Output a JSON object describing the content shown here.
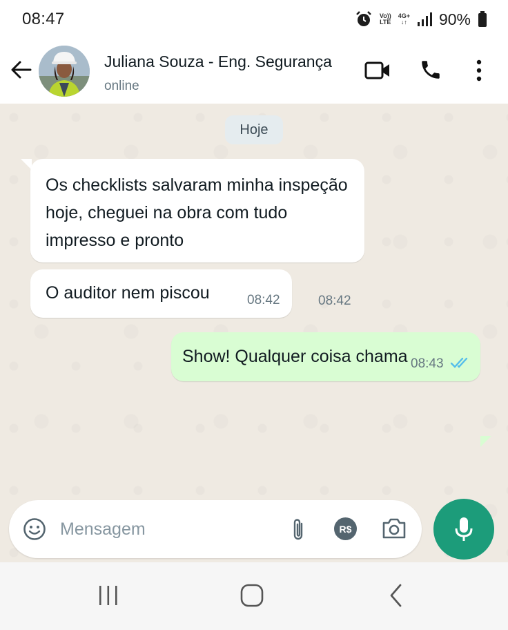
{
  "status_bar": {
    "time": "08:47",
    "volte_top": "Vo))",
    "volte_bottom": "LTE",
    "network": "4G+",
    "battery": "90%"
  },
  "header": {
    "contact_name": "Juliana Souza - Eng. Segurança",
    "contact_status": "online",
    "icons": [
      "back-arrow-icon",
      "video-call-icon",
      "voice-call-icon",
      "more-options-icon"
    ]
  },
  "chat": {
    "date_chip": "Hoje",
    "messages": [
      {
        "direction": "incoming",
        "text": "Os checklists salvaram minha inspeção hoje, cheguei na obra com tudo impresso e pronto",
        "time": "08:42"
      },
      {
        "direction": "incoming",
        "text": "O auditor nem piscou",
        "time": "08:42"
      },
      {
        "direction": "outgoing",
        "text": "Show! Qualquer coisa chama",
        "time": "08:43",
        "read": true
      }
    ]
  },
  "composer": {
    "placeholder": "Mensagem",
    "payment_label": "R$",
    "icons": [
      "emoji-icon",
      "attach-icon",
      "payment-icon",
      "camera-icon",
      "mic-icon"
    ]
  },
  "colors": {
    "incoming_bubble": "#ffffff",
    "outgoing_bubble": "#d9fdd3",
    "accent": "#1c9c7a",
    "read_ticks": "#53bdeb",
    "chat_background": "#efeae2"
  }
}
